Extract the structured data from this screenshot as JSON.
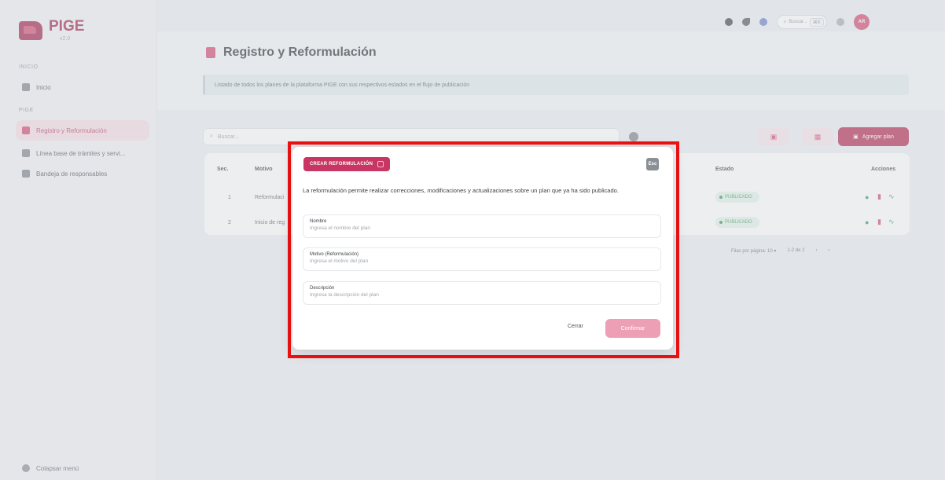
{
  "sidebar": {
    "logo_title": "PIGE",
    "logo_sub": "v2.0",
    "section_inicio": "INICIO",
    "section_pige": "PIGE",
    "items": [
      {
        "label": "Inicio"
      },
      {
        "label": "Registro y Reformulación"
      },
      {
        "label": "Línea base de trámites y servi..."
      },
      {
        "label": "Bandeja de responsables"
      }
    ],
    "collapse_label": "Colapsar menú"
  },
  "topbar": {
    "search_placeholder": "Buscar...",
    "shortcut": "⌘K",
    "avatar_initials": "AR"
  },
  "page": {
    "title": "Registro y Reformulación",
    "description": "Listado de todos los planes de la plataforma PIGE con sus respectivos estados en el flujo de publicación"
  },
  "toolbar": {
    "search_placeholder": "Buscar...",
    "add_label": "Agregar plan"
  },
  "table": {
    "headers": {
      "num": "Sec.",
      "motivo": "Motivo",
      "estado": "Estado",
      "acciones": "Acciones"
    },
    "rows": [
      {
        "num": "1",
        "motivo": "Reformulaci",
        "estado": "PUBLICADO"
      },
      {
        "num": "2",
        "motivo": "Inicio de reg",
        "estado": "PUBLICADO"
      }
    ],
    "pager": {
      "rows_label": "Filas por página: 10 ▾",
      "range": "1-2 de 2"
    }
  },
  "modal": {
    "badge": "CREAR REFORMULACIÓN",
    "close_label": "Esc",
    "intro": "La reformulación permite realizar correcciones, modificaciones y actualizaciones sobre un plan que ya ha sido publicado.",
    "fields": [
      {
        "label": "Nombre",
        "placeholder": "Ingresa el nombre del plan"
      },
      {
        "label": "Motivo (Reformulación)",
        "placeholder": "Ingresa el motivo del plan"
      },
      {
        "label": "Descripción",
        "placeholder": "Ingresa la descripción del plan"
      }
    ],
    "cancel_label": "Cerrar",
    "confirm_label": "Confirmar"
  },
  "colors": {
    "brand": "#b4284f",
    "accent_pink": "#d6486f",
    "confirm_disabled": "#ec9fb5",
    "highlight_frame": "#ee1111",
    "status_green": "#3b9a5a"
  }
}
